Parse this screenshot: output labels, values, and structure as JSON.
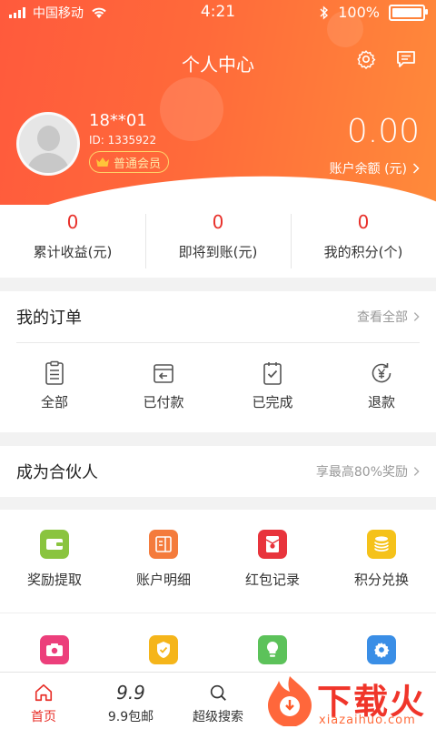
{
  "status_bar": {
    "carrier": "中国移动",
    "time": "4:21",
    "battery": "100%"
  },
  "header": {
    "title": "个人中心"
  },
  "user": {
    "name": "18**01",
    "id": "ID: 1335922",
    "level": "普通会员"
  },
  "account": {
    "balance": "0.00",
    "balance_label": "账户余额 (元)"
  },
  "stats": [
    {
      "value": "0",
      "label": "累计收益(元)"
    },
    {
      "value": "0",
      "label": "即将到账(元)"
    },
    {
      "value": "0",
      "label": "我的积分(个)"
    }
  ],
  "orders": {
    "title": "我的订单",
    "more": "查看全部",
    "items": [
      {
        "label": "全部",
        "icon": "clipboard-list-icon"
      },
      {
        "label": "已付款",
        "icon": "payment-return-icon"
      },
      {
        "label": "已完成",
        "icon": "clipboard-check-icon"
      },
      {
        "label": "退款",
        "icon": "yen-refund-icon"
      }
    ]
  },
  "partner": {
    "title": "成为合伙人",
    "more": "享最高80%奖励"
  },
  "tools": {
    "row1": [
      {
        "label": "奖励提取",
        "icon": "wallet-icon",
        "color": "#8ac43f"
      },
      {
        "label": "账户明细",
        "icon": "ledger-icon",
        "color": "#f47b3c"
      },
      {
        "label": "红包记录",
        "icon": "red-envelope-icon",
        "color": "#e8343c"
      },
      {
        "label": "积分兑换",
        "icon": "coins-icon",
        "color": "#f5c21a"
      }
    ],
    "row2": [
      {
        "icon": "camera-icon",
        "color": "#ec3f7b"
      },
      {
        "icon": "shield-check-icon",
        "color": "#f5b51a"
      },
      {
        "icon": "lightbulb-icon",
        "color": "#5cc25a"
      },
      {
        "icon": "gear-icon",
        "color": "#3a8ee6"
      }
    ]
  },
  "tabs": [
    {
      "label": "首页",
      "icon": "home-icon"
    },
    {
      "label": "9.9包邮",
      "icon_text": "9.9"
    },
    {
      "label": "超级搜索",
      "icon": "search-icon"
    }
  ],
  "watermark": {
    "title": "下载火",
    "site": "xiazaihuo.com"
  },
  "colors": {
    "accent": "#e8302a",
    "header_start": "#ff5a3c",
    "header_end": "#ff8a3a"
  }
}
